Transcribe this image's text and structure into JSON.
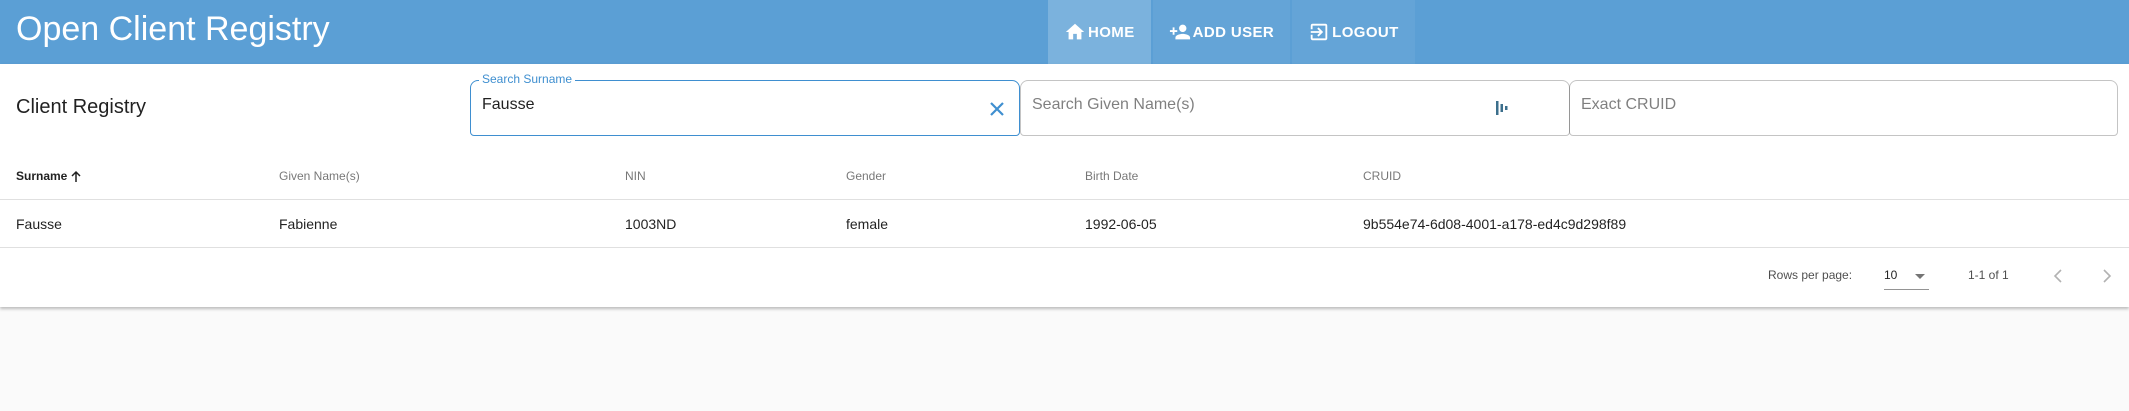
{
  "app": {
    "title": "Open Client Registry"
  },
  "nav": {
    "home_label": "HOME",
    "add_user_label": "ADD USER",
    "logout_label": "LOGOUT"
  },
  "registry": {
    "title": "Client Registry",
    "search_surname": {
      "label": "Search Surname",
      "value": "Fausse"
    },
    "search_given": {
      "placeholder": "Search Given Name(s)"
    },
    "exact_cruid": {
      "placeholder": "Exact CRUID"
    }
  },
  "table": {
    "columns": [
      "Surname",
      "Given Name(s)",
      "NIN",
      "Gender",
      "Birth Date",
      "CRUID"
    ],
    "rows": [
      [
        "Fausse",
        "Fabienne",
        "1003ND",
        "female",
        "1992-06-05",
        "9b554e74-6d08-4001-a178-ed4c9d298f89"
      ]
    ]
  },
  "pagination": {
    "rows_per_page_label": "Rows per page:",
    "rows_per_page": "10",
    "range": "1-1 of 1"
  },
  "colors": {
    "appbar": "#5b9fd5",
    "accent": "#3f8fd0"
  }
}
